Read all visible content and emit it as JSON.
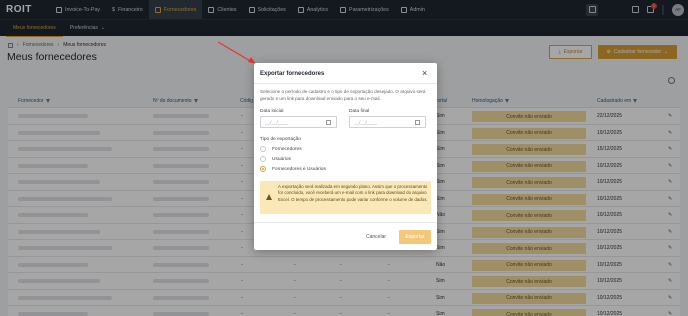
{
  "nav": {
    "logo": "ROIT",
    "items": [
      {
        "label": "Invoice-To-Pay",
        "icon": "invoice-icon"
      },
      {
        "label": "Financeiro",
        "icon": "dollar-icon"
      },
      {
        "label": "Fornecedores",
        "icon": "suppliers-icon"
      },
      {
        "label": "Clientes",
        "icon": "clients-icon"
      },
      {
        "label": "Solicitações",
        "icon": "requests-icon"
      },
      {
        "label": "Analytics",
        "icon": "analytics-icon"
      },
      {
        "label": "Parametrizações",
        "icon": "settings-icon"
      },
      {
        "label": "Admin",
        "icon": "admin-icon"
      }
    ],
    "notification_count": "1",
    "avatar_initials": "AF"
  },
  "subnav": {
    "items": [
      "Meus fornecedores",
      "Preferências"
    ]
  },
  "breadcrumb": [
    "Fornecedores",
    "Meus fornecedores"
  ],
  "page_title": "Meus fornecedores",
  "actions": {
    "export_label": "Exportar",
    "add_label": "Cadastrar fornecedor"
  },
  "table": {
    "headers": {
      "supplier": "Fornecedor",
      "document": "Nº do documento",
      "code": "Códig",
      "portal": "Portal",
      "homologation": "Homologação",
      "created": "Cadastrado em"
    },
    "rows": [
      {
        "code": "-",
        "portal": "Sim",
        "status": "Convite não enviado",
        "date": "22/12/2025"
      },
      {
        "code": "-",
        "portal": "Sim",
        "status": "Convite não enviado",
        "date": "19/12/2025"
      },
      {
        "code": "-",
        "portal": "Sim",
        "status": "Convite não enviado",
        "date": "15/12/2025"
      },
      {
        "code": "-",
        "portal": "Sim",
        "status": "Convite não enviado",
        "date": "10/12/2025"
      },
      {
        "code": "-",
        "portal": "Sim",
        "status": "Convite não enviado",
        "date": "10/12/2025"
      },
      {
        "code": "-",
        "portal": "Sim",
        "status": "Convite não enviado",
        "date": "10/12/2025"
      },
      {
        "code": "-",
        "portal": "Não",
        "status": "Convite não enviado",
        "date": "10/12/2025"
      },
      {
        "code": "-",
        "portal": "Sim",
        "status": "Convite não enviado",
        "date": "10/12/2025"
      },
      {
        "code": "-",
        "portal": "Sim",
        "status": "Convite não enviado",
        "date": "10/12/2025"
      },
      {
        "code": "-",
        "portal": "Não",
        "status": "Convite não enviado",
        "date": "10/12/2025"
      },
      {
        "code": "-",
        "portal": "Sim",
        "status": "Convite não enviado",
        "date": "10/12/2025"
      },
      {
        "code": "-",
        "portal": "Sim",
        "status": "Convite não enviado",
        "date": "10/12/2025"
      },
      {
        "code": "-",
        "portal": "Sim",
        "status": "Convite não enviado",
        "date": "10/12/2025"
      }
    ]
  },
  "modal": {
    "title": "Exportar fornecedores",
    "description": "Selecione o período de cadastro e o tipo de exportação desejado. O arquivo será gerado e um link para download enviado para o seu e-mail.",
    "start_label": "Data inicial",
    "end_label": "Data final",
    "date_placeholder": "__/__/____",
    "type_label": "Tipo de exportação",
    "options": [
      "Fornecedores",
      "Usuários",
      "Fornecedores e Usuários"
    ],
    "selected_option": "Fornecedores e Usuários",
    "warning": "A exportação será realizada em segundo plano. Assim que o processamento for concluído, você receberá um e-mail com o link para download do arquivo Excel. O tempo de processamento pode variar conforme o volume de dados.",
    "cancel_label": "Cancelar",
    "export_label": "Exportar"
  },
  "colors": {
    "accent": "#d99e35",
    "nav_bg": "#1f2630",
    "warning_bg": "#fbe8b8",
    "status_bg": "#f5dc9e",
    "arrow": "#e03a2f"
  }
}
